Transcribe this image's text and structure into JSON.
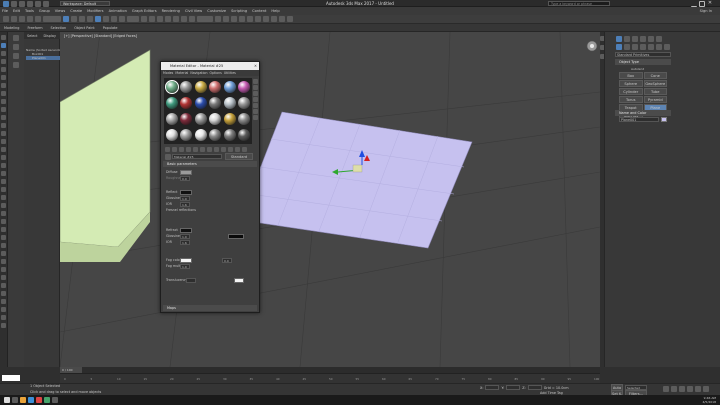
{
  "window": {
    "workspace_value": "Workspace: Default",
    "title": "Autodesk 3ds Max 2017 - Untitled",
    "search_placeholder": "Type a keyword or phrase"
  },
  "menubar": [
    "File",
    "Edit",
    "Tools",
    "Group",
    "Views",
    "Create",
    "Modifiers",
    "Animation",
    "Graph Editors",
    "Rendering",
    "Civil View",
    "Customize",
    "Scripting",
    "Content",
    "Help",
    "Sign In"
  ],
  "ribbon": [
    "Modeling",
    "Freeform",
    "Selection",
    "Object Paint",
    "Populate"
  ],
  "scene_explorer": {
    "tabs": [
      "Select",
      "Display"
    ],
    "items": [
      "Name (Sorted Ascending)",
      "Box001",
      "Plane001"
    ]
  },
  "viewport": {
    "label": "[+] [Perspective] [Standard] [Edged Faces]",
    "box_color": "#d9ecbd",
    "plane_color": "#c9c4ef"
  },
  "material_editor": {
    "title": "Material Editor - Material #25",
    "menu": [
      "Modes",
      "Material",
      "Navigation",
      "Options",
      "Utilities"
    ],
    "sphere_colors": [
      "#6fae88",
      "#9a9a9a",
      "#c9aa44",
      "#d06f6f",
      "#6f9ed8",
      "#c65bb3",
      "#3f9a7e",
      "#b13434",
      "#2b4dad",
      "#7a7a7a",
      "#b9c2c9",
      "#979797",
      "#a8a8a8",
      "#7e2b3b",
      "#989898",
      "#d8d8d8",
      "#c6a13a",
      "#8a8a8a",
      "#e0e0e0",
      "#a0a0a0",
      "#e8e8e8",
      "#8a8a8a",
      "#7c7c7c",
      "#5c5c5c"
    ],
    "material_name": "Material #25",
    "material_type": "Standard",
    "shader_rollout": "Basic parameters",
    "diffuse_label": "Diffuse",
    "roughness_label": "Roughness",
    "reflect_label": "Reflect",
    "glossiness_label": "Glossiness",
    "ior_label": "IOR",
    "fresnel_label": "Fresnel reflections",
    "refract_label": "Refract",
    "fog_color_label": "Fog color",
    "fog_mult_label": "Fog multiplier",
    "translucency_label": "Translucency",
    "maps_rollout": "Maps",
    "values": {
      "diffuse_val": "0.0",
      "gloss_val": "1.0",
      "ior_val": "1.6",
      "refr_gloss": "1.0",
      "refr_ior": "1.6",
      "fog_val": "0.0",
      "fog_mult": "1.0"
    }
  },
  "right_panel": {
    "category": "Standard Primitives",
    "object_type_title": "Object Type",
    "autogrid": "AutoGrid",
    "object_buttons": [
      "Box",
      "Cone",
      "Sphere",
      "GeoSphere",
      "Cylinder",
      "Tube",
      "Torus",
      "Pyramid",
      "Teapot",
      "Plane",
      "TextPlus"
    ],
    "name_color_title": "Name and Color",
    "name_value": "Plane001"
  },
  "timeline": {
    "frame_label": "0 / 100",
    "ticks": [
      "0",
      "5",
      "10",
      "15",
      "20",
      "25",
      "30",
      "35",
      "40",
      "45",
      "50",
      "55",
      "60",
      "65",
      "70",
      "75",
      "80",
      "85",
      "90",
      "95",
      "100"
    ]
  },
  "statusbar": {
    "selected": "1 Object Selected",
    "prompt": "Click and drag to select and move objects",
    "x_label": "X:",
    "y_label": "Y:",
    "z_label": "Z:",
    "grid": "Grid = 10.0cm",
    "addtime": "Add Time Tag",
    "auto_label": "Auto",
    "setkey_label": "Set K.",
    "selected_dropdown": "Selected",
    "filters_label": "Filters..."
  },
  "taskbar": {
    "time": "9:46 AM",
    "date": "4/5/2018"
  }
}
